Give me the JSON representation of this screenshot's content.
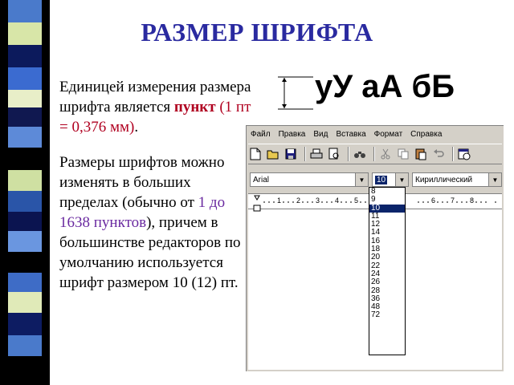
{
  "slide": {
    "title": "РАЗМЕР ШРИФТА",
    "para1": {
      "text1": "Единицей измерения размера шрифта является ",
      "bold": "пункт",
      "paren": " (1 пт = 0,376 мм)",
      "dot": "."
    },
    "para2": {
      "text1": " Размеры шрифтов можно изменять в больших пределах (обычно от ",
      "range": "1 до 1638 пунктов",
      "text2": "), причем в большинстве редакторов по умолчанию используется шрифт размером 10 (12) пт."
    },
    "sample": "уУ аА бБ"
  },
  "app": {
    "menu": [
      "Файл",
      "Правка",
      "Вид",
      "Вставка",
      "Формат",
      "Справка"
    ],
    "toolbar_icons": [
      "new-document-icon",
      "open-folder-icon",
      "save-icon",
      "print-icon",
      "preview-icon",
      "find-icon",
      "cut-icon",
      "copy-icon",
      "paste-icon",
      "undo-icon",
      "insert-datetime-icon"
    ],
    "font_name": "Arial",
    "font_size": "10",
    "charset": "Кириллический",
    "ruler_numbers": [
      "1",
      "2",
      "3",
      "4",
      "5",
      "6",
      "7",
      "8"
    ],
    "size_options": [
      "8",
      "9",
      "10",
      "11",
      "12",
      "14",
      "16",
      "18",
      "20",
      "22",
      "24",
      "26",
      "28",
      "36",
      "48",
      "72"
    ],
    "selected_size": "10"
  }
}
